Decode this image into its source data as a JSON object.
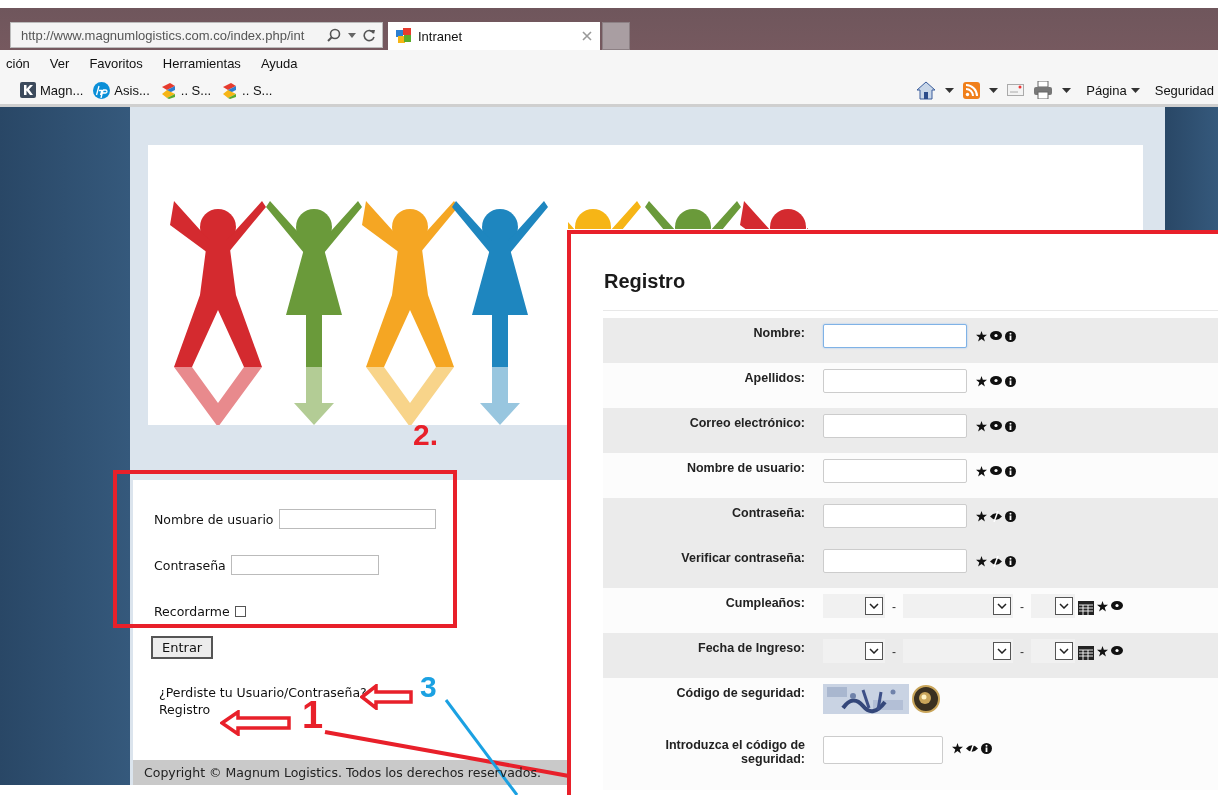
{
  "browser": {
    "address": "http://www.magnumlogistics.com.co/index.php/int",
    "tab": "Intranet",
    "menu": [
      "ción",
      "Ver",
      "Favoritos",
      "Herramientas",
      "Ayuda"
    ],
    "favorites": [
      "Magn...",
      "Asis...",
      ".. S...",
      ".. S..."
    ],
    "commands": [
      "Página",
      "Seguridad"
    ]
  },
  "login": {
    "fields": [
      {
        "label": "Nombre de usuario"
      },
      {
        "label": "Contraseña"
      }
    ],
    "remember": {
      "label": "Recordarme",
      "checked": false
    },
    "button": "Entrar",
    "links": [
      "¿Perdiste tu Usuario/Contraseña?",
      "Registro"
    ]
  },
  "footer": "Copyright © Magnum Logistics. Todos los derechos reservados.",
  "registro": {
    "title": "Registro",
    "rows": [
      {
        "label": "Nombre:",
        "kind": "text",
        "shaded": true,
        "focused": true
      },
      {
        "label": "Apellidos:",
        "kind": "text",
        "shaded": false,
        "focused": false
      },
      {
        "label": "Correo electrónico:",
        "kind": "text",
        "shaded": true,
        "focused": false
      },
      {
        "label": "Nombre de usuario:",
        "kind": "text",
        "shaded": false,
        "focused": false
      },
      {
        "label": "Contraseña:",
        "kind": "password",
        "shaded": true,
        "focused": false
      },
      {
        "label": "Verificar contraseña:",
        "kind": "password",
        "shaded": true,
        "focused": false
      },
      {
        "label": "Cumpleaños:",
        "kind": "date",
        "shaded": false,
        "separators": [
          "-",
          "-"
        ]
      },
      {
        "label": "Fecha de Ingreso:",
        "kind": "date",
        "shaded": true,
        "separators": [
          "-",
          "-"
        ]
      },
      {
        "label": "Código de seguridad:",
        "kind": "captcha",
        "shaded": false
      },
      {
        "label": "Introduzca el código de seguridad:",
        "kind": "captcha_input",
        "shaded": false,
        "focused": false
      }
    ]
  },
  "annotations": [
    {
      "label": "2.",
      "color": "#e8202a"
    },
    {
      "label": "3",
      "color": "#1ba1e2"
    },
    {
      "label": "1",
      "color": "#e8202a"
    }
  ]
}
